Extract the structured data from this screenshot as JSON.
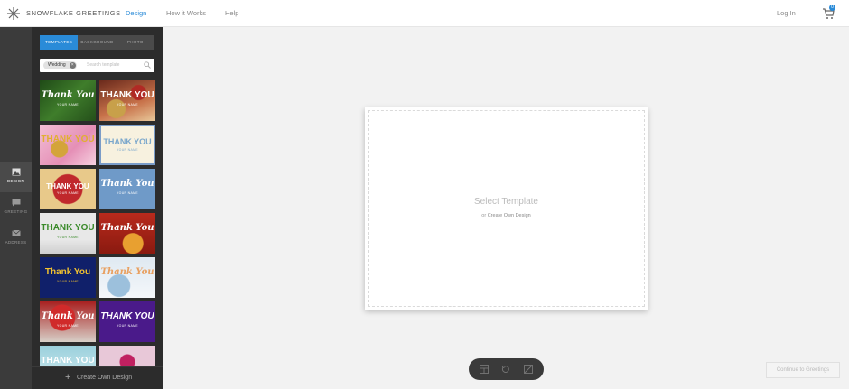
{
  "header": {
    "brand": "SNOWFLAKE GREETINGS",
    "nav": [
      "Design",
      "How it Works",
      "Help"
    ],
    "login": "Log In",
    "cart_count": "0"
  },
  "rail": {
    "items": [
      "DESIGN",
      "GREETING",
      "ADDRESS"
    ]
  },
  "panel": {
    "tabs": [
      "TEMPLATES",
      "BACKGROUND",
      "PHOTO"
    ],
    "search_chip": "Wedding",
    "search_placeholder": "Search template",
    "thumbs": [
      {
        "title": "Thank You",
        "sub": "YOUR NAME"
      },
      {
        "title": "THANK YOU",
        "sub": "YOUR NAME"
      },
      {
        "title": "THANK YOU",
        "sub": ""
      },
      {
        "title": "THANK YOU",
        "sub": "YOUR NAME"
      },
      {
        "title": "THANK YOU",
        "sub": "YOUR NAME"
      },
      {
        "title": "Thank You",
        "sub": "YOUR NAME"
      },
      {
        "title": "THANK YOU",
        "sub": "YOUR NAME"
      },
      {
        "title": "Thank You",
        "sub": ""
      },
      {
        "title": "Thank You",
        "sub": "YOUR NAME"
      },
      {
        "title": "Thank You",
        "sub": ""
      },
      {
        "title": "Thank You",
        "sub": "YOUR NAME"
      },
      {
        "title": "THANK YOU",
        "sub": "YOUR NAME"
      },
      {
        "title": "THANK YOU",
        "sub": ""
      },
      {
        "title": "",
        "sub": ""
      }
    ],
    "create_own": "Create Own Design"
  },
  "canvas": {
    "heading": "Select Template",
    "or_text": "or",
    "create_link": "Create Own Design"
  },
  "continue_button": "Continue to Greetings",
  "colors": {
    "accent": "#2a8bd8"
  }
}
